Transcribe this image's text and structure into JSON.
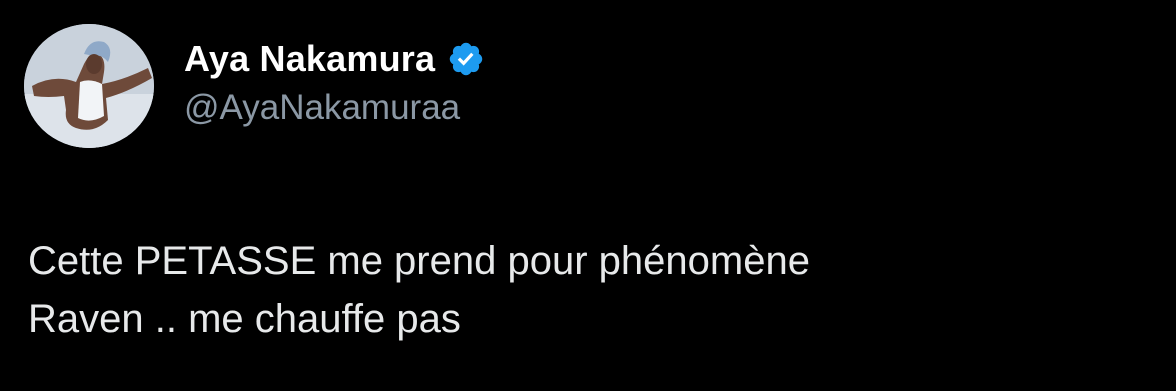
{
  "user": {
    "display_name": "Aya Nakamura",
    "handle": "@AyaNakamuraa",
    "verified": true,
    "avatar_icon": "profile-photo"
  },
  "tweet": {
    "lines": [
      "Cette PETASSE me prend pour phénomène",
      "Raven .. me chauffe pas"
    ]
  },
  "colors": {
    "background": "#000000",
    "name": "#ffffff",
    "handle": "#8b98a5",
    "text": "#e7e9ea",
    "verified_badge": "#1d9bf0"
  }
}
